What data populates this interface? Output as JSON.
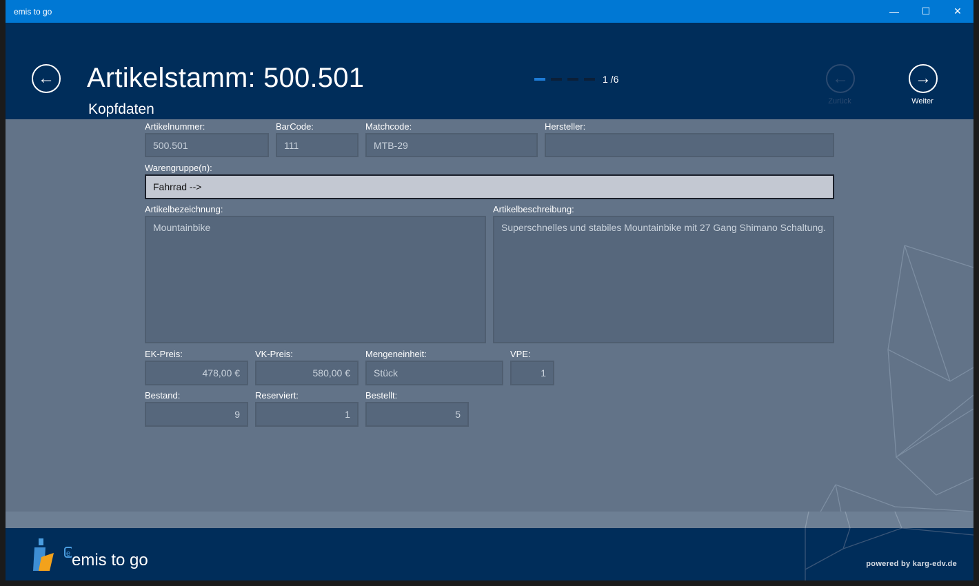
{
  "window": {
    "title": "emis to go",
    "minimize": "—",
    "maximize": "☐",
    "close": "✕"
  },
  "header": {
    "back_icon": "←",
    "title": "Artikelstamm: 500.501",
    "subtitle": "Kopfdaten",
    "page_indicator": "1 /6",
    "prev_icon": "←",
    "prev_label": "Zurück",
    "next_icon": "→",
    "next_label": "Weiter"
  },
  "form": {
    "artikelnummer": {
      "label": "Artikelnummer:",
      "value": "500.501"
    },
    "barcode": {
      "label": "BarCode:",
      "value": "111"
    },
    "matchcode": {
      "label": "Matchcode:",
      "value": "MTB-29"
    },
    "hersteller": {
      "label": "Hersteller:",
      "value": ""
    },
    "warengruppe": {
      "label": "Warengruppe(n):",
      "value": "Fahrrad -->"
    },
    "artikelbezeichnung": {
      "label": "Artikelbezeichnung:",
      "value": "Mountainbike"
    },
    "artikelbeschreibung": {
      "label": "Artikelbeschreibung:",
      "value": "Superschnelles und stabiles Mountainbike mit 27 Gang Shimano Schaltung."
    },
    "ek_preis": {
      "label": "EK-Preis:",
      "value": "478,00 €"
    },
    "vk_preis": {
      "label": "VK-Preis:",
      "value": "580,00 €"
    },
    "mengeneinheit": {
      "label": "Mengeneinheit:",
      "value": "Stück"
    },
    "vpe": {
      "label": "VPE:",
      "value": "1"
    },
    "bestand": {
      "label": "Bestand:",
      "value": "9"
    },
    "reserviert": {
      "label": "Reserviert:",
      "value": "1"
    },
    "bestellt": {
      "label": "Bestellt:",
      "value": "5"
    }
  },
  "footer": {
    "app_name": "emis to go",
    "powered_by": "powered by karg-edv.de"
  }
}
